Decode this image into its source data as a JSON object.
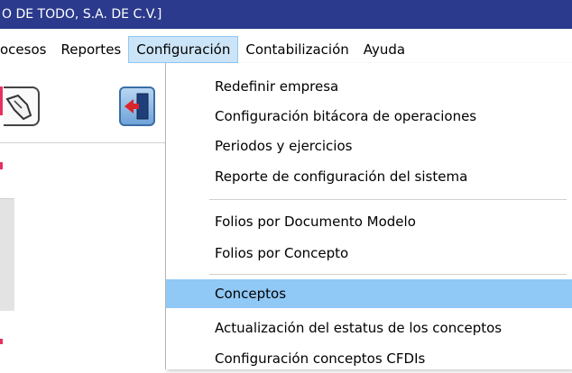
{
  "window": {
    "title": "O DE TODO, S.A. DE C.V.]"
  },
  "menubar": {
    "items": [
      {
        "label": "ocesos",
        "active": false
      },
      {
        "label": "Reportes",
        "active": false
      },
      {
        "label": "Configuración",
        "active": true
      },
      {
        "label": "Contabilización",
        "active": false
      },
      {
        "label": "Ayuda",
        "active": false
      }
    ]
  },
  "toolbar": {
    "icons": [
      "hand-icon",
      "exit-door-icon"
    ]
  },
  "dropdown": {
    "items": [
      {
        "label": "Redefinir empresa"
      },
      {
        "label": "Configuración bitácora de operaciones"
      },
      {
        "label": "Periodos y ejercicios"
      },
      {
        "label": "Reporte de configuración del sistema"
      },
      {
        "label": "Folios por Documento Modelo"
      },
      {
        "label": "Folios por Concepto"
      },
      {
        "label": "Conceptos",
        "selected": true
      },
      {
        "label": "Actualización del estatus de los conceptos"
      },
      {
        "label": "Configuración conceptos CFDIs"
      }
    ]
  },
  "colors": {
    "titlebar": "#2b3a8c",
    "menu_active": "#cce4f7",
    "selection": "#90c8f6",
    "edge_marks": "#e8305f"
  }
}
